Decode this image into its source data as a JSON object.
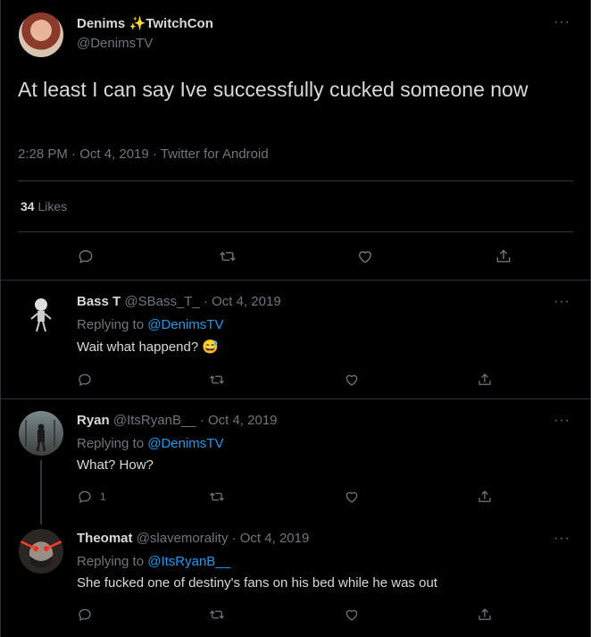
{
  "main_tweet": {
    "display_name": "Denims",
    "display_name_suffix": "TwitchCon",
    "sparkle": "✨",
    "handle": "@DenimsTV",
    "text": "At least I can say Ive successfully cucked someone now",
    "time": "2:28 PM · Oct 4, 2019 · Twitter for Android",
    "likes_count": "34",
    "likes_label": "Likes"
  },
  "replies": [
    {
      "display_name": "Bass T",
      "meta": "@SBass_T_ · Oct 4, 2019",
      "replying_prefix": "Replying to",
      "replying_to": "@DenimsTV",
      "text": "Wait what happend?",
      "emoji": "😅",
      "reply_count": ""
    },
    {
      "display_name": "Ryan",
      "meta": "@ItsRyanB__ · Oct 4, 2019",
      "replying_prefix": "Replying to",
      "replying_to": "@DenimsTV",
      "text": "What? How?",
      "reply_count": "1"
    },
    {
      "display_name": "Theomat",
      "meta": "@slavemorality · Oct 4, 2019",
      "replying_prefix": "Replying to",
      "replying_to": "@ItsRyanB__",
      "text": "She fucked one of destiny's fans on his bed while he was out",
      "reply_count": ""
    }
  ],
  "more_glyph": "···",
  "icons": [
    "reply-icon",
    "retweet-icon",
    "like-icon",
    "share-icon"
  ],
  "colors": {
    "background": "#000000",
    "text": "#d9d9d9",
    "muted": "#6e767d",
    "link": "#1d9bf0",
    "border": "#2f3336"
  }
}
